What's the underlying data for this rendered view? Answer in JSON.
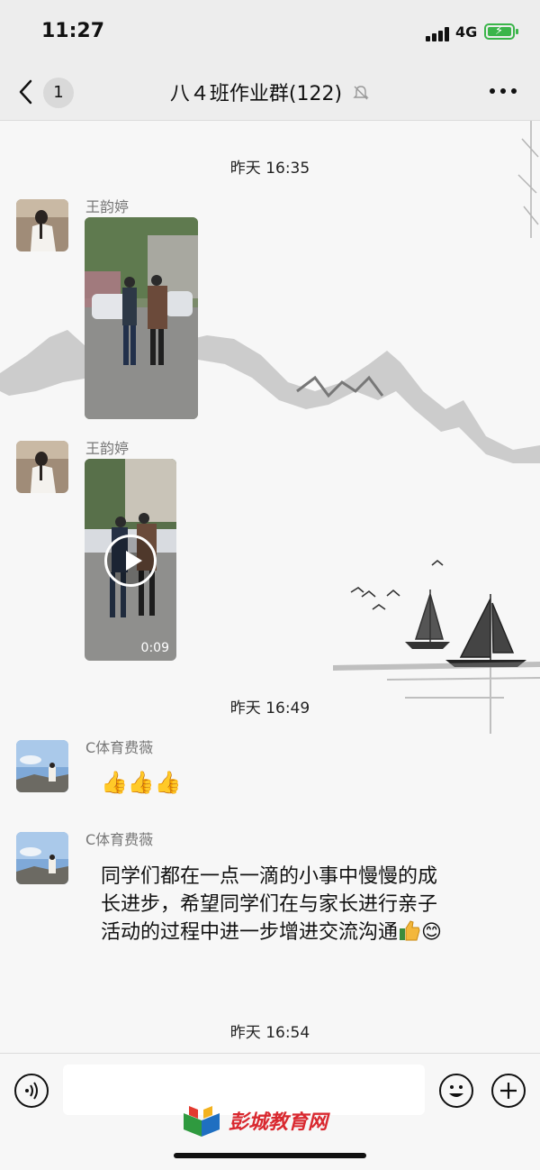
{
  "status_bar": {
    "time": "11:27",
    "network": "4G"
  },
  "nav": {
    "unread_count": "1",
    "title": "八４班作业群(122)"
  },
  "messages": [
    {
      "type": "timestamp",
      "text": "昨天 16:35"
    },
    {
      "type": "video",
      "sender": "王韵婷"
    },
    {
      "type": "video",
      "sender": "王韵婷",
      "duration": "0:09"
    },
    {
      "type": "timestamp",
      "text": "昨天 16:49"
    },
    {
      "type": "emoji",
      "sender": "C体育费薇",
      "content": "👍👍👍"
    },
    {
      "type": "text",
      "sender": "C体育费薇",
      "text": "同学们都在一点一滴的小事中慢慢的成长进步，希望同学们在与家长进行亲子活动的过程中进一步增进交流沟通",
      "trailing_emoji": "😊"
    },
    {
      "type": "timestamp",
      "text": "昨天 16:54"
    }
  ],
  "watermark": {
    "text": "彭城教育网"
  },
  "colors": {
    "battery": "#3bb54a",
    "watermark": "#d9282f"
  }
}
